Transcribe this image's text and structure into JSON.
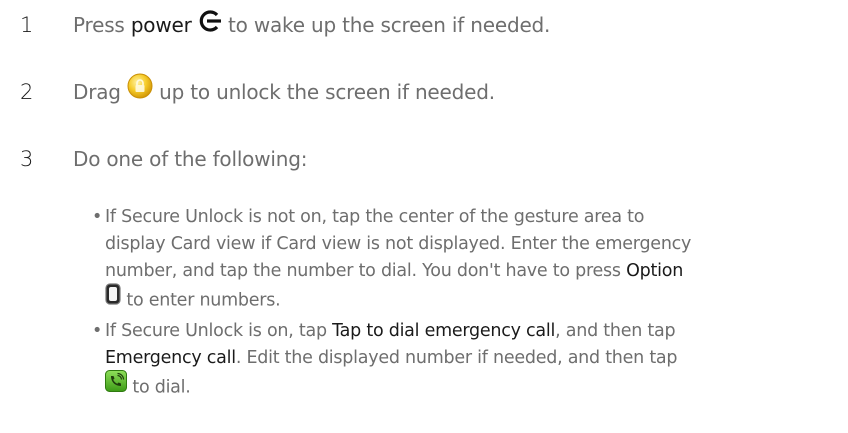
{
  "steps": [
    {
      "number": "1",
      "before": "Press",
      "em": "power",
      "icon": "power-icon",
      "after": "to wake up the screen if needed."
    },
    {
      "number": "2",
      "before": "Drag",
      "icon": "lock-icon",
      "after": "up to unlock the screen if needed."
    },
    {
      "number": "3",
      "text": "Do one of the following:"
    }
  ],
  "bullets": [
    {
      "line1": "If Secure Unlock is not on, tap the center of the gesture area to",
      "line2": "display Card view if Card view is not displayed. Enter the emergency",
      "line3_before": "number, and tap the number to dial. You don't have to press",
      "line3_em": "Option",
      "line4_icon": "option-key-icon",
      "line4_after": "to enter numbers."
    },
    {
      "line1_before": "If Secure Unlock is on, tap",
      "line1_em": "Tap to dial emergency call",
      "line1_after": ", and then tap",
      "line2_em": "Emergency call",
      "line2_after": ". Edit the displayed number if needed, and then tap",
      "line3_icon": "dial-phone-icon",
      "line3_after": "to dial."
    }
  ],
  "colors": {
    "body_text": "#6e6e6e",
    "emphasis_text": "#1a1a1a",
    "lock_icon": "#f2c11c",
    "dial_icon": "#5bbf2a"
  }
}
